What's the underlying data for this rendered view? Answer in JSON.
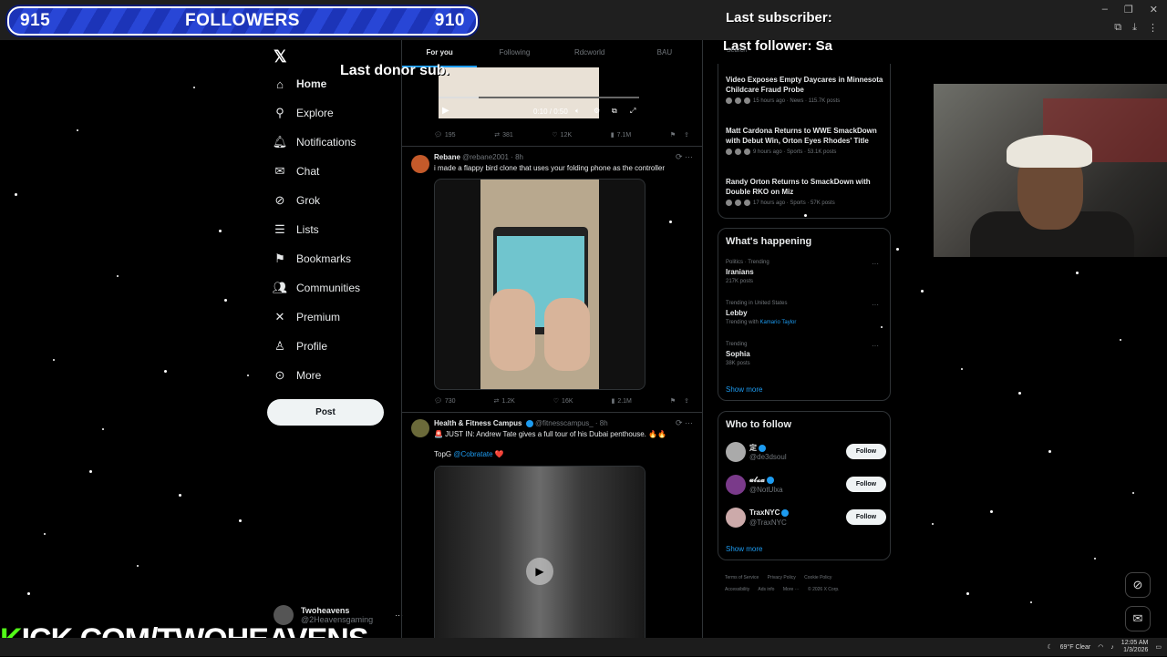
{
  "overlay": {
    "followers_left": "915",
    "followers_label": "FOLLOWERS",
    "followers_right": "910",
    "last_subscriber": "Last subscriber:",
    "last_follower": "Last follower: Sa",
    "last_donor": "Last donor sub.",
    "kick_url_k": "K",
    "kick_url_rest": "ICK.COM/TWOHEAVENS"
  },
  "nav": {
    "items": [
      {
        "label": "Home",
        "icon": "home-icon"
      },
      {
        "label": "Explore",
        "icon": "search-icon"
      },
      {
        "label": "Notifications",
        "icon": "bell-icon"
      },
      {
        "label": "Chat",
        "icon": "mail-icon"
      },
      {
        "label": "Grok",
        "icon": "grok-icon"
      },
      {
        "label": "Lists",
        "icon": "list-icon"
      },
      {
        "label": "Bookmarks",
        "icon": "bookmark-icon"
      },
      {
        "label": "Communities",
        "icon": "people-icon"
      },
      {
        "label": "Premium",
        "icon": "x-icon"
      },
      {
        "label": "Profile",
        "icon": "person-icon"
      },
      {
        "label": "More",
        "icon": "more-icon"
      }
    ],
    "post_label": "Post",
    "account_name": "Twoheavens",
    "account_handle": "@2Heavensgaming",
    "account_more": "···"
  },
  "feed": {
    "tabs": [
      "For you",
      "Following",
      "Rdcworld",
      "BAU"
    ],
    "video_time": "0:10 / 0:50",
    "post1_actions": {
      "replies": "195",
      "reposts": "381",
      "likes": "12K",
      "views": "7.1M"
    },
    "post2": {
      "name": "Rebane",
      "handle": "@rebane2001 · 8h",
      "text": "i made a flappy bird clone that uses your folding phone as the controller",
      "actions": {
        "replies": "730",
        "reposts": "1.2K",
        "likes": "16K",
        "views": "2.1M"
      }
    },
    "post3": {
      "name": "Health & Fitness Campus",
      "handle": "@fitnesscampus_ · 8h",
      "text": "🚨 JUST IN: Andrew Tate gives a full tour of his Dubai penthouse. 🔥🔥",
      "text2_prefix": "TopG ",
      "text2_mention": "@Cobratate",
      "text2_suffix": " ❤️"
    }
  },
  "sidebar": {
    "search_placeholder": "Search",
    "news": [
      {
        "title": "Video Exposes Empty Daycares in Minnesota Childcare Fraud Probe",
        "meta": "15 hours ago · News · 115.7K posts"
      },
      {
        "title": "Matt Cardona Returns to WWE SmackDown with Debut Win, Orton Eyes Rhodes' Title",
        "meta": "9 hours ago · Sports · 53.1K posts"
      },
      {
        "title": "Randy Orton Returns to SmackDown with Double RKO on Miz",
        "meta": "17 hours ago · Sports · 57K posts"
      }
    ],
    "happening_title": "What's happening",
    "trends": [
      {
        "category": "Politics · Trending",
        "name": "Iranians",
        "sub": "217K posts",
        "link": ""
      },
      {
        "category": "Trending in United States",
        "name": "Lebby",
        "sub": "Trending with ",
        "link": "Kamario Taylor"
      },
      {
        "category": "Trending",
        "name": "Sophia",
        "sub": "38K posts",
        "link": ""
      }
    ],
    "show_more": "Show more",
    "wtf_title": "Who to follow",
    "who_to_follow": [
      {
        "name": "定",
        "handle": "@de3dsoul",
        "button": "Follow"
      },
      {
        "name": "𝓾𝓵𝔁𝓪",
        "handle": "@NotUlxa",
        "button": "Follow"
      },
      {
        "name": "TraxNYC",
        "handle": "@TraxNYC",
        "button": "Follow"
      }
    ],
    "footer": [
      "Terms of Service",
      "Privacy Policy",
      "Cookie Policy",
      "Accessibility",
      "Ads info",
      "More ···",
      "© 2026 X Corp."
    ]
  },
  "taskbar": {
    "weather": "69°F  Clear",
    "time": "12:05 AM",
    "date": "1/3/2026"
  }
}
